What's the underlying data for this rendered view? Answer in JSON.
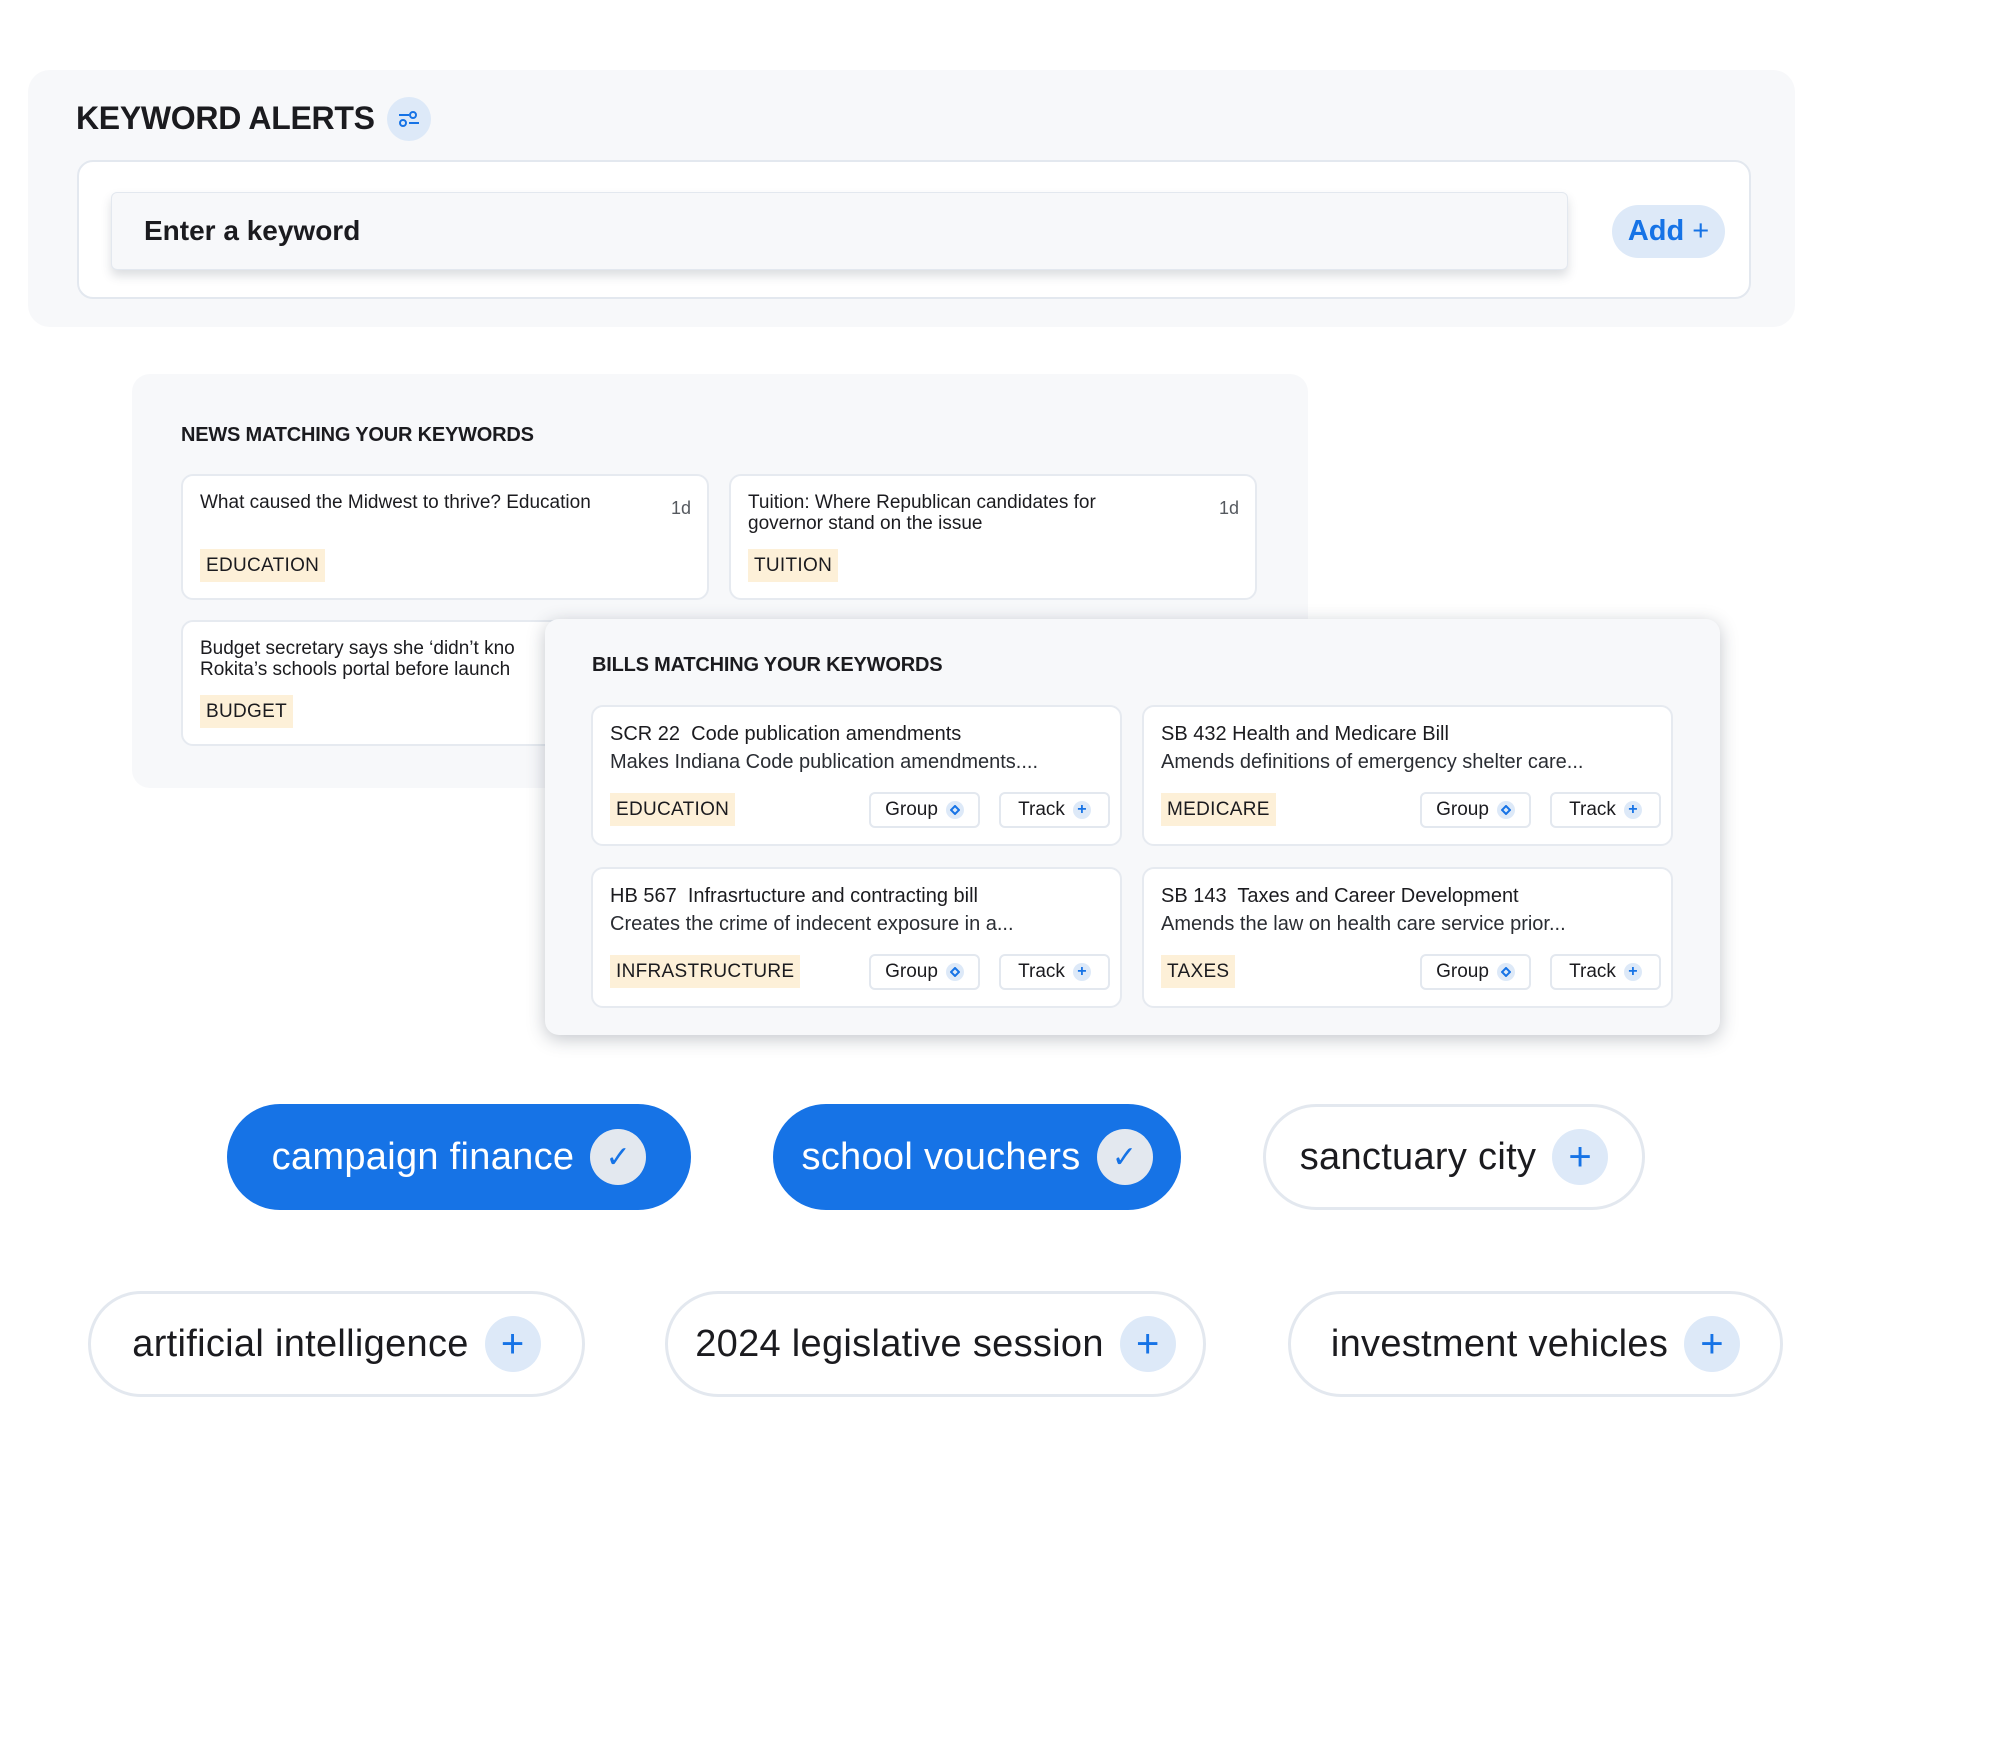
{
  "keyword_alerts": {
    "title": "KEYWORD ALERTS",
    "filter_icon": "sliders-icon",
    "input_placeholder": "Enter a keyword",
    "input_value": "",
    "add_label": "Add",
    "add_icon": "+"
  },
  "news": {
    "title": "NEWS MATCHING YOUR KEYWORDS",
    "items": [
      {
        "headline": "What caused the Midwest to thrive? Education",
        "age": "1d",
        "tag": "EDUCATION"
      },
      {
        "headline": "Tuition: Where Republican candidates for\ngovernor stand on the issue",
        "age": "1d",
        "tag": "TUITION"
      },
      {
        "headline": "Budget secretary says she ‘didn’t kno\nRokita’s schools portal before launch",
        "age": "",
        "tag": "BUDGET"
      }
    ]
  },
  "bills": {
    "title": "BILLS MATCHING YOUR KEYWORDS",
    "group_label": "Group",
    "track_label": "Track",
    "items": [
      {
        "title": "SCR 22  Code publication amendments",
        "desc": "Makes Indiana Code publication amendments....",
        "tag": "EDUCATION"
      },
      {
        "title": "SB 432 Health and Medicare Bill",
        "desc": "Amends definitions of emergency shelter care...",
        "tag": "MEDICARE"
      },
      {
        "title": "HB 567  Infrasrtucture and contracting bill",
        "desc": "Creates the crime of indecent exposure in a...",
        "tag": "INFRASTRUCTURE"
      },
      {
        "title": "SB 143  Taxes and Career Development",
        "desc": "Amends the law on health care service prior...",
        "tag": "TAXES"
      }
    ]
  },
  "keywords": [
    {
      "label": "campaign finance",
      "selected": true
    },
    {
      "label": "school vouchers",
      "selected": true
    },
    {
      "label": "sanctuary city",
      "selected": false
    },
    {
      "label": "artificial intelligence",
      "selected": false
    },
    {
      "label": "2024 legislative session",
      "selected": false
    },
    {
      "label": "investment vehicles",
      "selected": false
    }
  ],
  "colors": {
    "accent": "#1673e6",
    "tag_bg": "#fdf0d8",
    "panel_bg": "#f7f8fa"
  }
}
